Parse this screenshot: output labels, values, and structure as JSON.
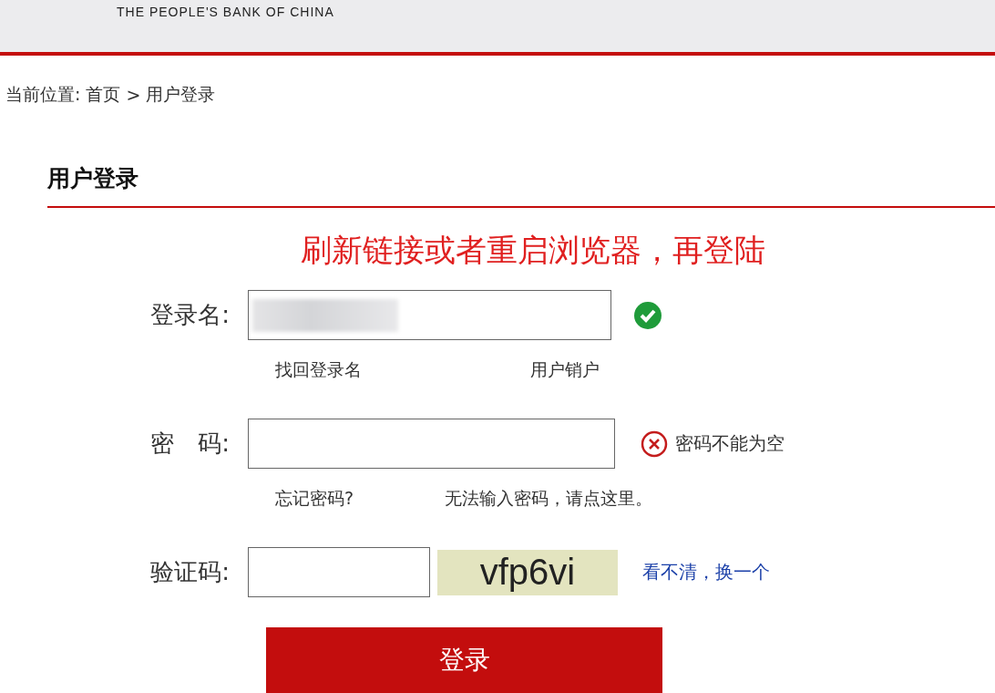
{
  "header": {
    "org_name": "THE PEOPLE'S BANK OF CHINA"
  },
  "breadcrumb": {
    "label": "当前位置:",
    "items": [
      {
        "text": "首页"
      },
      {
        "text": "用户登录"
      }
    ],
    "separator": ">"
  },
  "panel_title": "用户登录",
  "notice": "刷新链接或者重启浏览器，再登陆",
  "fields": [
    {
      "kind": "text",
      "label": "登录名:",
      "redacted": true,
      "valid": true,
      "error": false,
      "links": [
        "找回登录名",
        "用户销户"
      ]
    },
    {
      "kind": "password",
      "label": "密　码:",
      "redacted": false,
      "valid": false,
      "error": true,
      "message": "密码不能为空",
      "links": [
        "忘记密码?",
        "无法输入密码，请点这里。"
      ]
    },
    {
      "kind": "captcha",
      "label": "验证码:",
      "redacted": false,
      "valid": false,
      "error": false,
      "captcha_text": "vfp6vi",
      "refresh_link": "看不清，换一个"
    }
  ],
  "submit_button": "登录"
}
